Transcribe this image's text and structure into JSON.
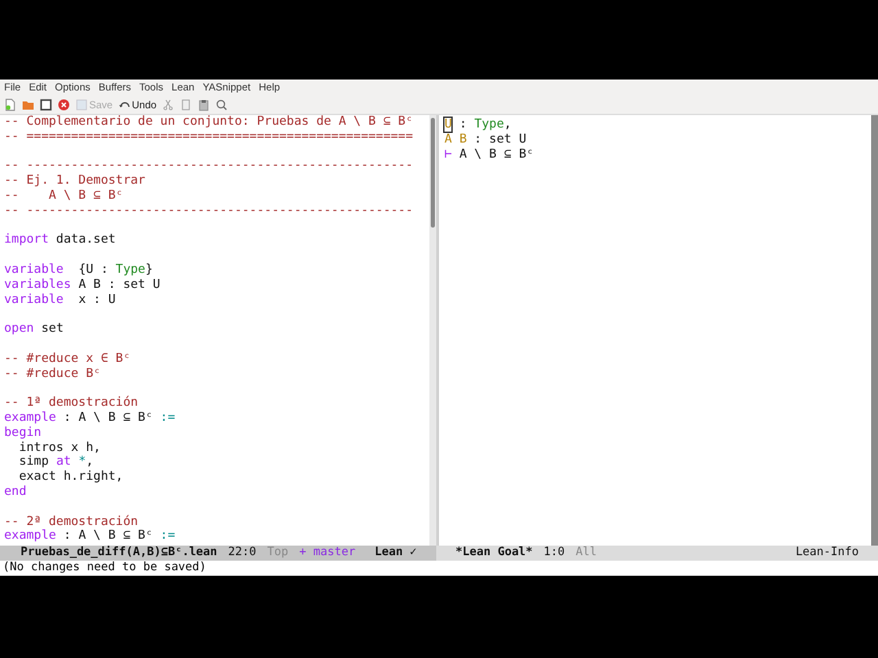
{
  "menu": [
    "File",
    "Edit",
    "Options",
    "Buffers",
    "Tools",
    "Lean",
    "YASnippet",
    "Help"
  ],
  "toolbar": [
    {
      "label": "Save",
      "disabled": true
    },
    {
      "label": "Undo",
      "disabled": false
    }
  ],
  "editor": {
    "lines": [
      {
        "kind": "code",
        "segments": [
          {
            "text": "-- Complementario de un conjunto: Pruebas de A \\ B ⊆ Bᶜ",
            "kind": "comment"
          }
        ]
      },
      {
        "kind": "code",
        "segments": [
          {
            "text": "-- ====================================================",
            "kind": "comment"
          }
        ]
      },
      {
        "kind": "blank"
      },
      {
        "kind": "code",
        "segments": [
          {
            "text": "-- ----------------------------------------------------",
            "kind": "comment"
          }
        ]
      },
      {
        "kind": "code",
        "segments": [
          {
            "text": "-- Ej. 1. Demostrar",
            "kind": "comment"
          }
        ]
      },
      {
        "kind": "code",
        "segments": [
          {
            "text": "--    A \\ B ⊆ Bᶜ",
            "kind": "comment"
          }
        ]
      },
      {
        "kind": "code",
        "segments": [
          {
            "text": "-- ----------------------------------------------------",
            "kind": "comment"
          }
        ]
      },
      {
        "kind": "blank"
      },
      {
        "kind": "code",
        "segments": [
          {
            "text": "import",
            "kind": "keyword"
          },
          {
            "text": " data.set",
            "kind": "plain"
          }
        ]
      },
      {
        "kind": "blank"
      },
      {
        "kind": "code",
        "segments": [
          {
            "text": "variable",
            "kind": "keyword"
          },
          {
            "text": "  {U : ",
            "kind": "plain"
          },
          {
            "text": "Type",
            "kind": "type"
          },
          {
            "text": "}",
            "kind": "plain"
          }
        ]
      },
      {
        "kind": "code",
        "segments": [
          {
            "text": "variables",
            "kind": "keyword"
          },
          {
            "text": " A B : set U",
            "kind": "plain"
          }
        ]
      },
      {
        "kind": "code",
        "segments": [
          {
            "text": "variable",
            "kind": "keyword"
          },
          {
            "text": "  x : U",
            "kind": "plain"
          }
        ]
      },
      {
        "kind": "blank"
      },
      {
        "kind": "code",
        "segments": [
          {
            "text": "open",
            "kind": "keyword"
          },
          {
            "text": " set",
            "kind": "plain"
          }
        ]
      },
      {
        "kind": "blank"
      },
      {
        "kind": "code",
        "segments": [
          {
            "text": "-- #reduce x ∈ Bᶜ",
            "kind": "comment"
          }
        ]
      },
      {
        "kind": "code",
        "segments": [
          {
            "text": "-- #reduce Bᶜ",
            "kind": "comment"
          }
        ]
      },
      {
        "kind": "blank"
      },
      {
        "kind": "code",
        "segments": [
          {
            "text": "-- 1ª demostración",
            "kind": "comment"
          }
        ]
      },
      {
        "kind": "code",
        "segments": [
          {
            "text": "example",
            "kind": "keyword"
          },
          {
            "text": " : A \\ B ⊆ Bᶜ ",
            "kind": "plain"
          },
          {
            "text": ":=",
            "kind": "operator"
          }
        ]
      },
      {
        "kind": "code",
        "segments": [
          {
            "text": "begin",
            "kind": "keyword"
          }
        ]
      },
      {
        "kind": "code",
        "segments": [
          {
            "text": "  intros x h,",
            "kind": "plain"
          }
        ]
      },
      {
        "kind": "code",
        "segments": [
          {
            "text": "  simp ",
            "kind": "plain"
          },
          {
            "text": "at",
            "kind": "keyword"
          },
          {
            "text": " *",
            "kind": "operator"
          },
          {
            "text": ",",
            "kind": "plain"
          }
        ]
      },
      {
        "kind": "code",
        "segments": [
          {
            "text": "  exact h.right,",
            "kind": "plain"
          }
        ]
      },
      {
        "kind": "code",
        "segments": [
          {
            "text": "end",
            "kind": "keyword"
          }
        ]
      },
      {
        "kind": "blank"
      },
      {
        "kind": "code",
        "segments": [
          {
            "text": "-- 2ª demostración",
            "kind": "comment"
          }
        ]
      },
      {
        "kind": "code",
        "segments": [
          {
            "text": "example",
            "kind": "keyword"
          },
          {
            "text": " : A \\ B ⊆ Bᶜ ",
            "kind": "plain"
          },
          {
            "text": ":=",
            "kind": "operator"
          }
        ]
      }
    ]
  },
  "goal": {
    "lines": [
      [
        {
          "text": "U",
          "kind": "cursor"
        },
        {
          "text": " : ",
          "kind": "plain"
        },
        {
          "text": "Type",
          "kind": "type"
        },
        {
          "text": ",",
          "kind": "plain"
        }
      ],
      [
        {
          "text": "A B",
          "kind": "var"
        },
        {
          "text": " : set U",
          "kind": "plain"
        }
      ],
      [
        {
          "text": "⊢",
          "kind": "turnstile"
        },
        {
          "text": " A \\ B ⊆ Bᶜ",
          "kind": "plain"
        }
      ]
    ]
  },
  "mode_lines": [
    [
      {
        "text": "Pruebas_de_diff(A,B)⊆Bᶜ.lean",
        "kind": "buffer"
      },
      {
        "text": "22:0",
        "kind": "plain"
      },
      {
        "text": "Top",
        "kind": "dim"
      },
      {
        "text": "+ master",
        "kind": "vc"
      },
      {
        "text": "Lean ✓",
        "kind": "buffer"
      }
    ],
    [
      {
        "text": "*Lean Goal*",
        "kind": "buffer"
      },
      {
        "text": "1:0",
        "kind": "plain"
      },
      {
        "text": "All",
        "kind": "dim"
      },
      {
        "text": "Lean-Info",
        "kind": "mode"
      }
    ]
  ],
  "echo": "(No changes need to be saved)"
}
